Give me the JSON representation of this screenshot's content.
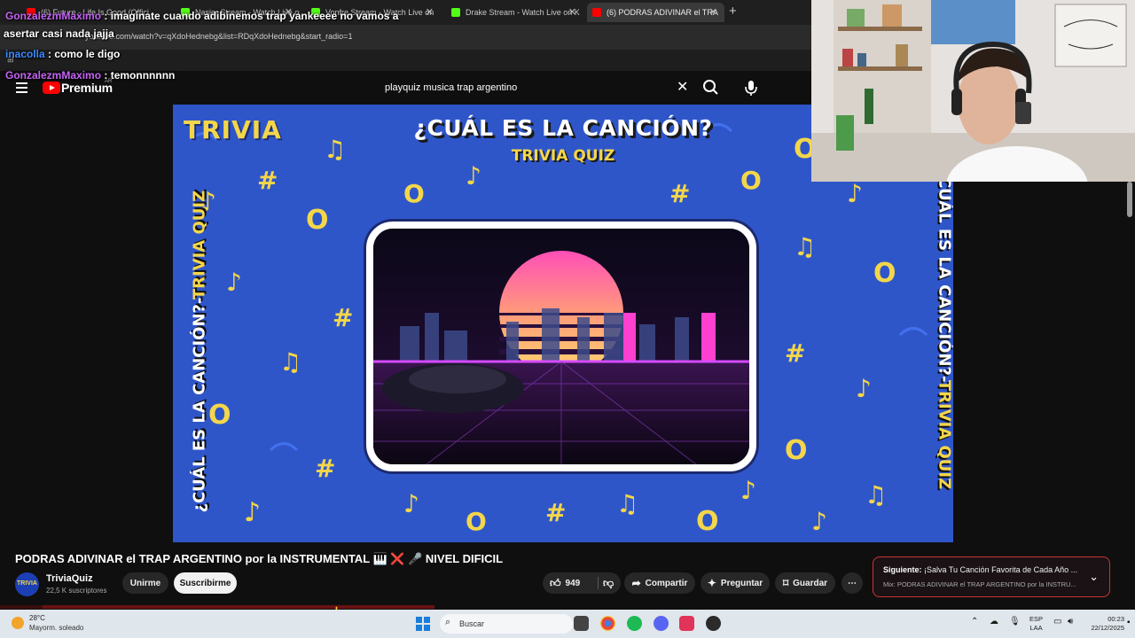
{
  "browser": {
    "tabs": [
      {
        "label": "(6) Future - Life Is Good (Offici",
        "color": "#ff0000"
      },
      {
        "label": "Nasier Stream - Watch Live on",
        "color": "#53fc18"
      },
      {
        "label": "Vonfre Stream - Watch Live on",
        "color": "#53fc18"
      },
      {
        "label": "Drake Stream - Watch Live on K",
        "color": "#53fc18"
      },
      {
        "label": "(6) PODRAS ADIVINAR el TRA",
        "color": "#ff0000"
      }
    ],
    "url": "youtube.com/watch?v=qXdoHednebg&list=RDqXdoHednebg&start_radio=1"
  },
  "youtube": {
    "logo_text": "Premium",
    "search_value": "playquiz musica trap argentino"
  },
  "video": {
    "brand": "TRIVIA",
    "headline": "¿CUÁL ES LA CANCIÓN?",
    "subheadline": "TRIVIA QUIZ",
    "side_white": "¿CUÁL ES LA CANCIÓN?-",
    "side_yellow": "TRIVIA QUIZ"
  },
  "meta": {
    "title": "PODRAS ADIVINAR el TRAP ARGENTINO por la INSTRUMENTAL 🎹 ❌ 🎤 NIVEL DIFICIL",
    "channel_name": "TriviaQuiz",
    "channel_avatar_text": "TRIVIA",
    "subscribers": "22,5 K suscriptores",
    "join_label": "Unirme",
    "subscribe_label": "Suscribirme",
    "likes": "949",
    "share_label": "Compartir",
    "ask_label": "Preguntar",
    "save_label": "Guardar"
  },
  "next": {
    "label": "Siguiente:",
    "title": "¡Salva Tu Canción Favorita de Cada Año ...",
    "mix": "Mix: PODRAS ADIVINAR el TRAP ARGENTINO por la INSTRU..."
  },
  "chat": [
    {
      "user": "GonzalezmMaximo",
      "text": ": imaginate cuando adibinemos trap yankeeee no vamos a",
      "color": "#c565f5"
    },
    {
      "user": "",
      "text": "asertar casi nada jajja",
      "color": "#ffffff"
    },
    {
      "user": "inacolla",
      "text": ": como le digo",
      "color": "#3d8bff"
    },
    {
      "user": "GonzalezmMaximo",
      "text": ": temonnnnnn",
      "color": "#c565f5"
    }
  ],
  "taskbar": {
    "temperature": "28°C",
    "weather": "Mayorm. soleado",
    "search_label": "Buscar",
    "lang_top": "ESP",
    "lang_bottom": "LAA",
    "time": "00:23",
    "date": "22/12/2025"
  }
}
